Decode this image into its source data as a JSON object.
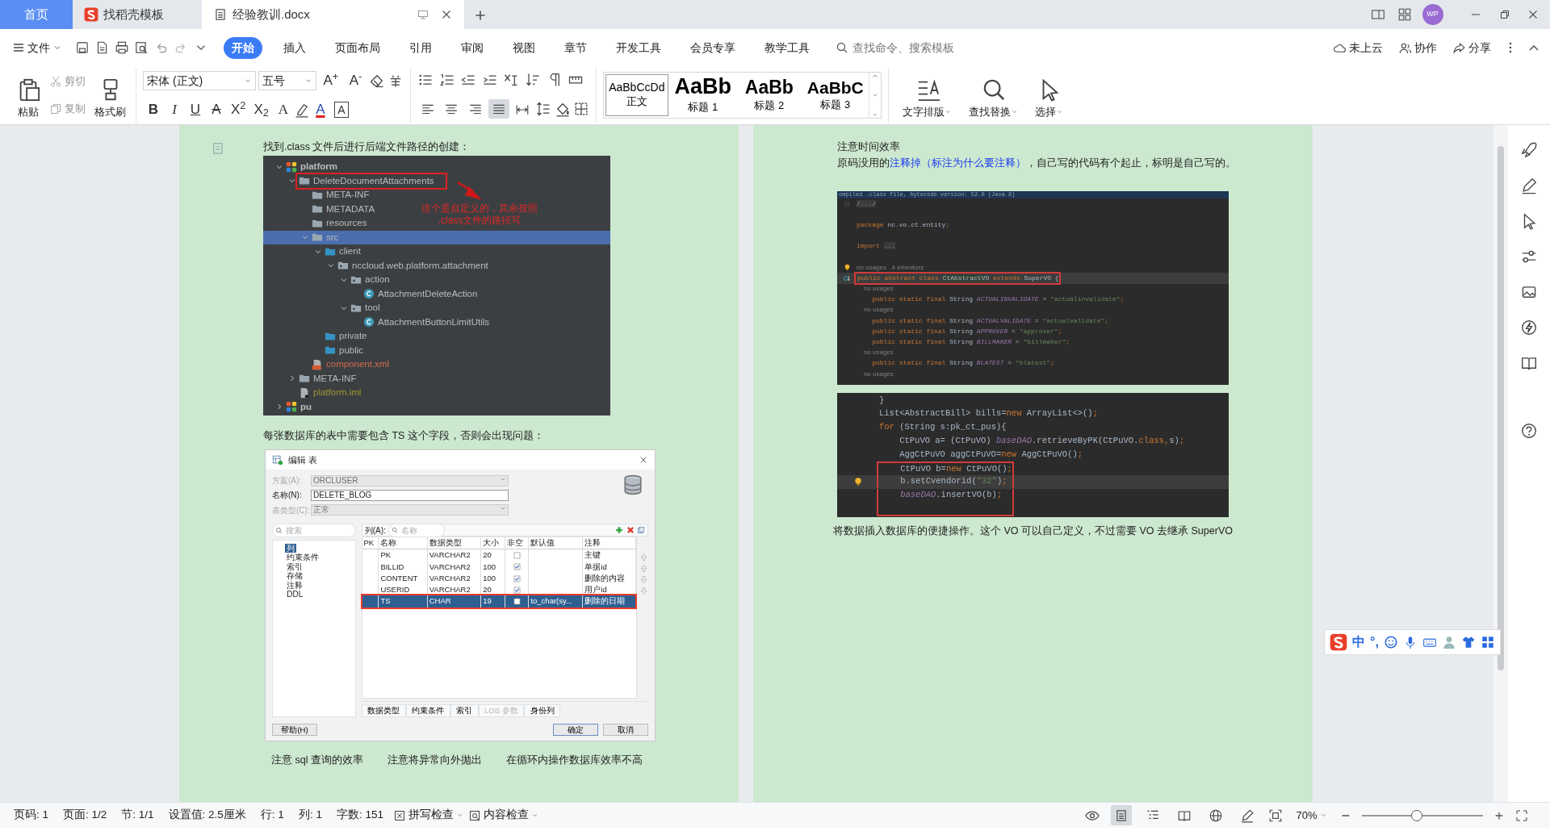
{
  "tabs": [
    {
      "label": "首页",
      "kind": "home",
      "selected": false
    },
    {
      "label": "找稻壳模板",
      "kind": "docer",
      "selected": false
    },
    {
      "label": "经验教训.docx",
      "kind": "doc",
      "selected": true
    }
  ],
  "account": {
    "initials": "WP"
  },
  "menu": {
    "file": "文件",
    "tabs": [
      {
        "label": "开始",
        "selected": true
      },
      {
        "label": "插入",
        "selected": false
      },
      {
        "label": "页面布局",
        "selected": false
      },
      {
        "label": "引用",
        "selected": false
      },
      {
        "label": "审阅",
        "selected": false
      },
      {
        "label": "视图",
        "selected": false
      },
      {
        "label": "章节",
        "selected": false
      },
      {
        "label": "开发工具",
        "selected": false
      },
      {
        "label": "会员专享",
        "selected": false
      },
      {
        "label": "教学工具",
        "selected": false
      }
    ],
    "search": {
      "placeholder": "查找命令、搜索模板"
    },
    "actions": [
      {
        "label": "未上云",
        "kind": "cloud"
      },
      {
        "label": "协作",
        "kind": "people"
      },
      {
        "label": "分享",
        "kind": "share"
      }
    ]
  },
  "ribbon": {
    "paste": "粘贴",
    "cut": {
      "label": "剪切",
      "disabled": true
    },
    "copy": {
      "label": "复制",
      "disabled": true
    },
    "format_painter": "格式刷",
    "font": "宋体 (正文)",
    "size": "五号",
    "grow": "A$^{+}$",
    "shrink": "A$^{-}$",
    "format_buttons": [
      {
        "kind": "bold",
        "text": "B"
      },
      {
        "kind": "italic",
        "text": "I"
      },
      {
        "kind": "underline",
        "text": "U"
      },
      {
        "kind": "strike",
        "text": "A"
      },
      {
        "kind": "sup",
        "text": "X$^{2}$"
      },
      {
        "kind": "sub",
        "text": "X$_{2}$"
      },
      {
        "kind": "effect",
        "text": "A"
      },
      {
        "kind": "highlight"
      },
      {
        "kind": "color",
        "text": "A"
      },
      {
        "kind": "border",
        "text": "A"
      }
    ],
    "align": [
      {
        "kind": "left",
        "selected": false
      },
      {
        "kind": "center",
        "selected": false
      },
      {
        "kind": "right",
        "selected": false
      },
      {
        "kind": "justify",
        "selected": true
      },
      {
        "kind": "distributed",
        "selected": false
      }
    ],
    "styles": [
      {
        "preview": "AaBbCcDd",
        "label": "正文",
        "kind": "body",
        "selected": true
      },
      {
        "preview": "AaBb",
        "label": "标题 1",
        "kind": "h1",
        "selected": false
      },
      {
        "preview": "AaBb",
        "label": "标题 2",
        "kind": "h2",
        "selected": false
      },
      {
        "preview": "AaBbC",
        "label": "标题 3",
        "kind": "h3",
        "selected": false
      }
    ],
    "big_buttons": [
      {
        "label": "文字排版",
        "kind": "layout"
      },
      {
        "label": "查找替换",
        "kind": "find"
      },
      {
        "label": "选择",
        "kind": "select"
      }
    ]
  },
  "pages": [
    {
      "blocks": [
        {
          "kind": "paragraph",
          "segments": [
            {
              "text": "找到.class 文件后进行后端文件路径的创建：",
              "kind": "plain"
            }
          ]
        },
        {
          "kind": "ide_tree",
          "annotation": {
            "lines": [
              "这个是自定义的，其余按照",
              ".class文件的路径写"
            ]
          },
          "nodes": [
            {
              "label": "platform",
              "kind": "module",
              "expanded": true,
              "selected": false,
              "boxed": false,
              "children": [
                {
                  "label": "DeleteDocumentAttachments",
                  "kind": "folder",
                  "expanded": true,
                  "selected": false,
                  "boxed": true,
                  "children": [
                    {
                      "label": "META-INF",
                      "kind": "folder",
                      "selected": false,
                      "boxed": false
                    },
                    {
                      "label": "METADATA",
                      "kind": "folder",
                      "selected": false,
                      "boxed": false
                    },
                    {
                      "label": "resources",
                      "kind": "folder",
                      "selected": false,
                      "boxed": false
                    },
                    {
                      "label": "src",
                      "kind": "folder",
                      "expanded": true,
                      "selected": true,
                      "boxed": false,
                      "children": [
                        {
                          "label": "client",
                          "kind": "source",
                          "expanded": true,
                          "selected": false,
                          "boxed": false,
                          "children": [
                            {
                              "label": "nccloud.web.platform.attachment",
                              "kind": "package",
                              "expanded": true,
                              "selected": false,
                              "boxed": false,
                              "children": [
                                {
                                  "label": "action",
                                  "kind": "package",
                                  "expanded": true,
                                  "selected": false,
                                  "boxed": false,
                                  "children": [
                                    {
                                      "label": "AttachmentDeleteAction",
                                      "kind": "class",
                                      "selected": false,
                                      "boxed": false
                                    }
                                  ]
                                },
                                {
                                  "label": "tool",
                                  "kind": "package",
                                  "expanded": true,
                                  "selected": false,
                                  "boxed": false,
                                  "children": [
                                    {
                                      "label": "AttachmentButtonLimitUtils",
                                      "kind": "class",
                                      "selected": false,
                                      "boxed": false
                                    }
                                  ]
                                }
                              ]
                            }
                          ]
                        },
                        {
                          "label": "private",
                          "kind": "source",
                          "selected": false,
                          "boxed": false
                        },
                        {
                          "label": "public",
                          "kind": "source",
                          "selected": false,
                          "boxed": false
                        }
                      ]
                    },
                    {
                      "label": "component.xml",
                      "kind": "xml",
                      "selected": false,
                      "boxed": false
                    }
                  ]
                },
                {
                  "label": "META-INF",
                  "kind": "folder",
                  "expanded": false,
                  "selected": false,
                  "boxed": false
                },
                {
                  "label": "platform.iml",
                  "kind": "iml",
                  "selected": false,
                  "boxed": false
                }
              ]
            },
            {
              "label": "pu",
              "kind": "module",
              "expanded": false,
              "selected": false,
              "boxed": false
            }
          ]
        },
        {
          "kind": "paragraph",
          "segments": [
            {
              "text": "每张数据库的表中需要包含 TS 这个字段，否则会出现问题：",
              "kind": "plain"
            }
          ]
        },
        {
          "kind": "db_dialog",
          "title": "编辑 表",
          "fields": [
            {
              "label": "方案(A):",
              "value": "ORCLUSER",
              "kind": "select",
              "disabled": true
            },
            {
              "label": "名称(N):",
              "value": "DELETE_BLOG",
              "kind": "text",
              "disabled": false
            },
            {
              "label": "表类型(C):",
              "value": "正常",
              "kind": "select",
              "disabled": true
            }
          ],
          "nav_search": "搜索",
          "nav": [
            {
              "label": "列",
              "selected": true
            },
            {
              "label": "约束条件",
              "selected": false
            },
            {
              "label": "索引",
              "selected": false
            },
            {
              "label": "存储",
              "selected": false
            },
            {
              "label": "注释",
              "selected": false
            },
            {
              "label": "DDL",
              "selected": false
            }
          ],
          "columns_label": "列(A):",
          "columns_search": "名称",
          "headers": [
            "PK",
            "名称",
            "数据类型",
            "大小",
            "非空",
            "默认值",
            "注释"
          ],
          "rows": [
            {
              "name": "PK",
              "type": "VARCHAR2",
              "size": "20",
              "not_null": false,
              "comment": "主键",
              "selected": false,
              "boxed": false
            },
            {
              "name": "BILLID",
              "type": "VARCHAR2",
              "size": "100",
              "not_null": true,
              "comment": "单据id",
              "selected": false,
              "boxed": false
            },
            {
              "name": "CONTENT",
              "type": "VARCHAR2",
              "size": "100",
              "not_null": true,
              "comment": "删除的内容",
              "selected": false,
              "boxed": false
            },
            {
              "name": "USERID",
              "type": "VARCHAR2",
              "size": "20",
              "not_null": true,
              "comment": "用户id",
              "selected": false,
              "boxed": false
            },
            {
              "name": "TS",
              "type": "CHAR",
              "size": "19",
              "not_null": false,
              "default": "to_char(sy...",
              "comment": "删除的日期",
              "selected": true,
              "boxed": true
            }
          ],
          "bottom_tabs": [
            {
              "label": "数据类型",
              "disabled": false
            },
            {
              "label": "约束条件",
              "disabled": false
            },
            {
              "label": "索引",
              "disabled": false
            },
            {
              "label": "LOB 参数",
              "disabled": true
            },
            {
              "label": "身份列",
              "disabled": false
            }
          ],
          "buttons": [
            {
              "label": "帮助(H)",
              "kind": "help"
            },
            {
              "label": "确定",
              "kind": "ok"
            },
            {
              "label": "取消",
              "kind": "cancel"
            }
          ]
        },
        {
          "kind": "captions",
          "items": [
            "注意 sql 查询的效率",
            "注意将异常向外抛出",
            "在循环内操作数据库效率不高"
          ]
        }
      ]
    },
    {
      "blocks": [
        {
          "kind": "paragraph",
          "segments": [
            {
              "text": "注意时间效率",
              "kind": "plain"
            }
          ]
        },
        {
          "kind": "paragraph",
          "segments": [
            {
              "text": "原码没用的",
              "kind": "plain"
            },
            {
              "text": "注释掉（标注为什么要注释）",
              "kind": "blue"
            },
            {
              "text": "，自己写的代码有个起止，标明是自己写的。",
              "kind": "plain"
            }
          ]
        },
        {
          "kind": "bytecode",
          "header": "ompiled .class file, bytecode version: 52.0 (Java 8)",
          "lines": [
            {
              "kind": "code",
              "boxed": false,
              "current": false,
              "tokens": [
                {
                  "kind": "fold",
                  "text": "/.../"
                }
              ]
            },
            {
              "kind": "blank",
              "boxed": false,
              "current": false
            },
            {
              "kind": "code",
              "boxed": false,
              "current": false,
              "tokens": [
                {
                  "kind": "kw",
                  "text": "package "
                },
                {
                  "kind": "plain",
                  "text": "nc.vo.ct.entity"
                },
                {
                  "kind": "kw",
                  "text": ";"
                }
              ]
            },
            {
              "kind": "blank",
              "boxed": false,
              "current": false
            },
            {
              "kind": "code",
              "boxed": false,
              "current": false,
              "tokens": [
                {
                  "kind": "kw",
                  "text": "import "
                },
                {
                  "kind": "fold",
                  "text": "..."
                }
              ]
            },
            {
              "kind": "blank",
              "boxed": false,
              "current": false
            },
            {
              "kind": "hint",
              "boxed": false,
              "current": false,
              "marker": {
                "kind": "bulb"
              },
              "text": "no usages   4 inheritors"
            },
            {
              "kind": "code",
              "boxed": true,
              "current": true,
              "marker": {
                "kind": "override"
              },
              "tokens": [
                {
                  "kind": "kw",
                  "text": "public abstract class "
                },
                {
                  "kind": "cls",
                  "text": "CtAbstractVO"
                },
                {
                  "kind": "kw",
                  "text": " extends "
                },
                {
                  "kind": "plain",
                  "text": "SuperVO {"
                }
              ]
            },
            {
              "kind": "hint",
              "boxed": false,
              "current": false,
              "text": "    no usages"
            },
            {
              "kind": "code",
              "boxed": false,
              "current": false,
              "tokens": [
                {
                  "kind": "kw",
                  "text": "    public static final "
                },
                {
                  "kind": "plain",
                  "text": "String "
                },
                {
                  "kind": "const",
                  "text": "ACTUALINVALIDATE"
                },
                {
                  "kind": "plain",
                  "text": " = "
                },
                {
                  "kind": "str",
                  "text": "\"actualinvalidate\""
                },
                {
                  "kind": "kw",
                  "text": ";"
                }
              ]
            },
            {
              "kind": "hint",
              "boxed": false,
              "current": false,
              "text": "    no usages"
            },
            {
              "kind": "code",
              "boxed": false,
              "current": false,
              "tokens": [
                {
                  "kind": "kw",
                  "text": "    public static final "
                },
                {
                  "kind": "plain",
                  "text": "String "
                },
                {
                  "kind": "const",
                  "text": "ACTUALVALIDATE"
                },
                {
                  "kind": "plain",
                  "text": " = "
                },
                {
                  "kind": "str",
                  "text": "\"actualvalidate\""
                },
                {
                  "kind": "kw",
                  "text": ";"
                }
              ]
            },
            {
              "kind": "code",
              "boxed": false,
              "current": false,
              "tokens": [
                {
                  "kind": "kw",
                  "text": "    public static final "
                },
                {
                  "kind": "plain",
                  "text": "String "
                },
                {
                  "kind": "const",
                  "text": "APPROVER"
                },
                {
                  "kind": "plain",
                  "text": " = "
                },
                {
                  "kind": "str",
                  "text": "\"approver\""
                },
                {
                  "kind": "kw",
                  "text": ";"
                }
              ]
            },
            {
              "kind": "code",
              "boxed": false,
              "current": false,
              "tokens": [
                {
                  "kind": "kw",
                  "text": "    public static final "
                },
                {
                  "kind": "plain",
                  "text": "String "
                },
                {
                  "kind": "const",
                  "text": "BILLMAKER"
                },
                {
                  "kind": "plain",
                  "text": " = "
                },
                {
                  "kind": "str",
                  "text": "\"billmaker\""
                },
                {
                  "kind": "kw",
                  "text": ";"
                }
              ]
            },
            {
              "kind": "hint",
              "boxed": false,
              "current": false,
              "text": "    no usages"
            },
            {
              "kind": "code",
              "boxed": false,
              "current": false,
              "tokens": [
                {
                  "kind": "kw",
                  "text": "    public static final "
                },
                {
                  "kind": "plain",
                  "text": "String "
                },
                {
                  "kind": "const",
                  "text": "BLATEST"
                },
                {
                  "kind": "plain",
                  "text": " = "
                },
                {
                  "kind": "str",
                  "text": "\"blatest\""
                },
                {
                  "kind": "kw",
                  "text": ";"
                }
              ]
            },
            {
              "kind": "hint",
              "boxed": false,
              "current": false,
              "text": "    no usages"
            }
          ]
        },
        {
          "kind": "code",
          "lines": [
            {
              "kind": "code",
              "boxed": false,
              "current": false,
              "tokens": [
                {
                  "kind": "plain",
                  "text": "}"
                }
              ]
            },
            {
              "kind": "code",
              "boxed": false,
              "current": false,
              "tokens": [
                {
                  "kind": "plain",
                  "text": "List<AbstractBill> bills="
                },
                {
                  "kind": "kw",
                  "text": "new"
                },
                {
                  "kind": "plain",
                  "text": " ArrayList<>()"
                },
                {
                  "kind": "kw",
                  "text": ";"
                }
              ]
            },
            {
              "kind": "code",
              "boxed": false,
              "current": false,
              "tokens": [
                {
                  "kind": "kw",
                  "text": "for"
                },
                {
                  "kind": "plain",
                  "text": " (String s:pk_ct_pus){"
                }
              ]
            },
            {
              "kind": "code",
              "boxed": false,
              "current": false,
              "tokens": [
                {
                  "kind": "plain",
                  "text": "    CtPuVO a= (CtPuVO) "
                },
                {
                  "kind": "const",
                  "text": "baseDAO"
                },
                {
                  "kind": "plain",
                  "text": ".retrieveByPK(CtPuVO."
                },
                {
                  "kind": "kw",
                  "text": "class,"
                },
                {
                  "kind": "plain",
                  "text": "s)"
                },
                {
                  "kind": "kw",
                  "text": ";"
                }
              ]
            },
            {
              "kind": "code",
              "boxed": false,
              "current": false,
              "tokens": [
                {
                  "kind": "plain",
                  "text": "    AggCtPuVO aggCtPuVO="
                },
                {
                  "kind": "kw",
                  "text": "new"
                },
                {
                  "kind": "plain",
                  "text": " AggCtPuVO()"
                },
                {
                  "kind": "kw",
                  "text": ";"
                }
              ]
            },
            {
              "kind": "code",
              "boxed": true,
              "current": false,
              "tokens": [
                {
                  "kind": "plain",
                  "text": "    CtPuVO b="
                },
                {
                  "kind": "kw",
                  "text": "new"
                },
                {
                  "kind": "plain",
                  "text": " CtPuVO()"
                },
                {
                  "kind": "kw",
                  "text": ";"
                }
              ]
            },
            {
              "kind": "code",
              "boxed": true,
              "current": true,
              "marker": {
                "kind": "bulb"
              },
              "tokens": [
                {
                  "kind": "plain",
                  "text": "    b.setCvendorid("
                },
                {
                  "kind": "str",
                  "text": "\"32\""
                },
                {
                  "kind": "plain",
                  "text": ")"
                },
                {
                  "kind": "kw",
                  "text": ";"
                }
              ]
            },
            {
              "kind": "code",
              "boxed": true,
              "current": false,
              "tokens": [
                {
                  "kind": "const",
                  "text": "    baseDAO"
                },
                {
                  "kind": "plain",
                  "text": ".insertVO(b)"
                },
                {
                  "kind": "kw",
                  "text": ";"
                }
              ]
            },
            {
              "kind": "blank",
              "boxed": true,
              "current": false
            }
          ]
        },
        {
          "kind": "paragraph",
          "center": true,
          "segments": [
            {
              "text": "将数据插入数据库的便捷操作。这个 VO 可以自己定义，不过需要 VO 去继承 SuperVO",
              "kind": "plain"
            }
          ]
        }
      ]
    }
  ],
  "ime": {
    "labels": [
      "中",
      "°,"
    ]
  },
  "status": {
    "items": [
      "页码: 1",
      "页面: 1/2",
      "节: 1/1",
      "设置值: 2.5厘米",
      "行: 1",
      "列: 1",
      "字数: 151"
    ],
    "checks": [
      {
        "label": "拼写检查",
        "kind": "spell"
      },
      {
        "label": "内容检查",
        "kind": "content"
      }
    ],
    "views": [
      {
        "kind": "page",
        "selected": true
      },
      {
        "kind": "outline",
        "selected": false
      },
      {
        "kind": "read",
        "selected": false
      },
      {
        "kind": "web",
        "selected": false
      },
      {
        "kind": "pen",
        "selected": false
      }
    ],
    "zoom": {
      "label": "70%",
      "level": 0.45
    }
  }
}
